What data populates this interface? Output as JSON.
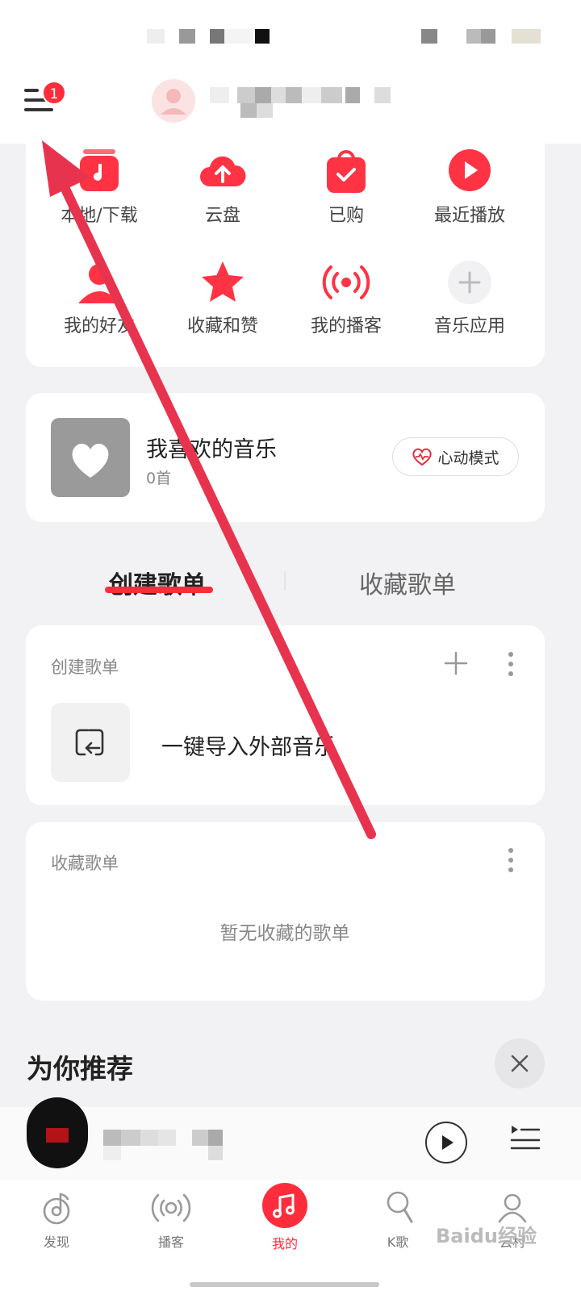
{
  "header": {
    "menu_badge": "1"
  },
  "quick_grid": [
    {
      "label": "本地/下载",
      "icon": "local-download-icon"
    },
    {
      "label": "云盘",
      "icon": "cloud-upload-icon"
    },
    {
      "label": "已购",
      "icon": "purchased-bag-icon"
    },
    {
      "label": "最近播放",
      "icon": "recent-play-icon"
    },
    {
      "label": "我的好友",
      "icon": "friends-icon"
    },
    {
      "label": "收藏和赞",
      "icon": "star-icon"
    },
    {
      "label": "我的播客",
      "icon": "podcast-icon"
    },
    {
      "label": "音乐应用",
      "icon": "plus-icon"
    }
  ],
  "favorite": {
    "title": "我喜欢的音乐",
    "count": "0首",
    "mode_button": "心动模式"
  },
  "tabs": {
    "active": "创建歌单",
    "inactive": "收藏歌单"
  },
  "created_section": {
    "label": "创建歌单",
    "import_text": "一键导入外部音乐"
  },
  "collected_section": {
    "label": "收藏歌单",
    "empty_text": "暂无收藏的歌单"
  },
  "recommend": {
    "title": "为你推荐"
  },
  "bottom_nav": [
    {
      "label": "发现",
      "icon": "discover-icon"
    },
    {
      "label": "播客",
      "icon": "podcast-nav-icon"
    },
    {
      "label": "我的",
      "icon": "music-note-icon"
    },
    {
      "label": "K歌",
      "icon": "microphone-icon"
    },
    {
      "label": "云村",
      "icon": "community-icon"
    }
  ],
  "watermark": "Baidu经验",
  "colors": {
    "accent": "#ff2d3b",
    "background": "#f2f2f4",
    "annotation_arrow": "#e8334f"
  }
}
